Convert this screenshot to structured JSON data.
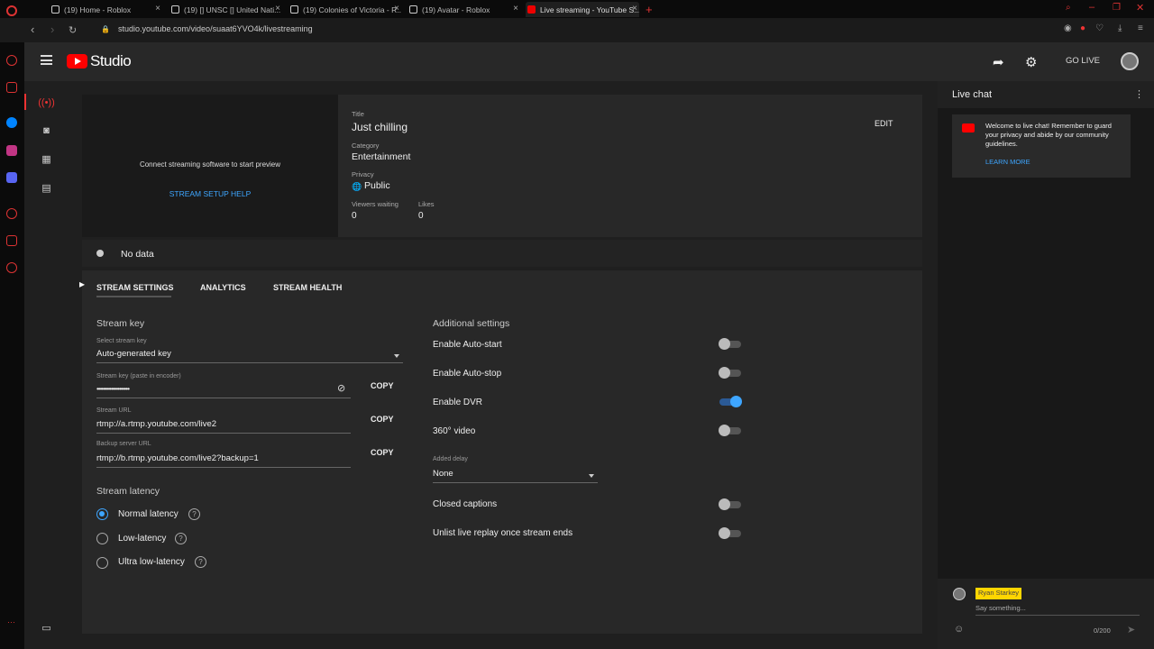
{
  "browser": {
    "tabs": [
      {
        "title": "(19) Home - Roblox"
      },
      {
        "title": "(19) [] UNSC [] United Nati..."
      },
      {
        "title": "(19) Colonies of Victoria - R..."
      },
      {
        "title": "(19) Avatar - Roblox"
      },
      {
        "title": "Live streaming - YouTube S..."
      }
    ],
    "url": "studio.youtube.com/video/suaat6YVO4k/livestreaming"
  },
  "header": {
    "brand": "Studio",
    "go_live": "GO LIVE"
  },
  "preview": {
    "message": "Connect streaming software to start preview",
    "help_link": "STREAM SETUP HELP"
  },
  "info": {
    "title_label": "Title",
    "title": "Just chilling",
    "category_label": "Category",
    "category": "Entertainment",
    "privacy_label": "Privacy",
    "privacy": "Public",
    "viewers_label": "Viewers waiting",
    "viewers": "0",
    "likes_label": "Likes",
    "likes": "0",
    "edit": "EDIT"
  },
  "status": {
    "text": "No data"
  },
  "tabs": [
    {
      "label": "STREAM SETTINGS",
      "active": true
    },
    {
      "label": "ANALYTICS",
      "active": false
    },
    {
      "label": "STREAM HEALTH",
      "active": false
    }
  ],
  "stream_key": {
    "section_title": "Stream key",
    "select_label": "Select stream key",
    "select_value": "Auto-generated key",
    "key_label": "Stream key (paste in encoder)",
    "key_value": "••••••••••••••••••••",
    "url_label": "Stream URL",
    "url_value": "rtmp://a.rtmp.youtube.com/live2",
    "backup_label": "Backup server URL",
    "backup_value": "rtmp://b.rtmp.youtube.com/live2?backup=1",
    "copy": "COPY"
  },
  "latency": {
    "section_title": "Stream latency",
    "options": [
      {
        "label": "Normal latency",
        "selected": true
      },
      {
        "label": "Low-latency",
        "selected": false
      },
      {
        "label": "Ultra low-latency",
        "selected": false
      }
    ]
  },
  "additional": {
    "section_title": "Additional settings",
    "auto_start": {
      "label": "Enable Auto-start",
      "on": false
    },
    "auto_stop": {
      "label": "Enable Auto-stop",
      "on": false
    },
    "dvr": {
      "label": "Enable DVR",
      "on": true
    },
    "video360": {
      "label": "360° video",
      "on": false
    },
    "delay_label": "Added delay",
    "delay_value": "None",
    "captions": {
      "label": "Closed captions",
      "on": false
    },
    "unlist": {
      "label": "Unlist live replay once stream ends",
      "on": false
    }
  },
  "chat": {
    "title": "Live chat",
    "welcome": "Welcome to live chat! Remember to guard your privacy and abide by our community guidelines.",
    "learn_more": "LEARN MORE",
    "user": "Ryan Starkey",
    "placeholder": "Say something...",
    "count": "0/200"
  },
  "colors": {
    "accent": "#3ea6ff",
    "brand_red": "#ff0000",
    "background": "#1f1f1f"
  }
}
